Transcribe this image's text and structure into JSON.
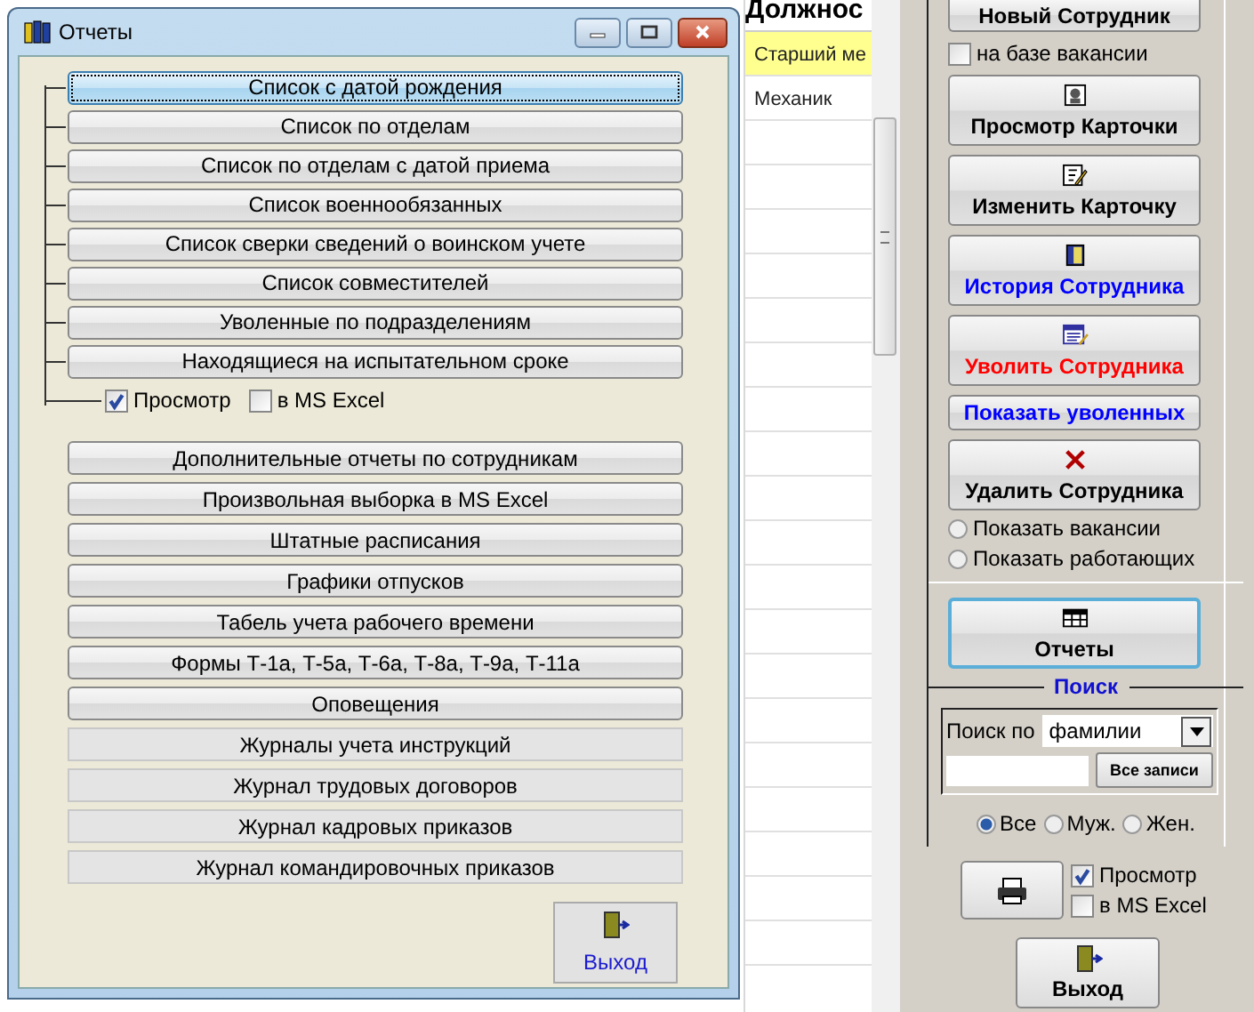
{
  "table": {
    "header": "Должнос",
    "rows": [
      {
        "cell": "Старший ме",
        "selected": true
      },
      {
        "cell": "Механик",
        "selected": false
      }
    ]
  },
  "side_panel": {
    "top_button": "Новый Сотрудник",
    "vacancy_check": {
      "label": "на базе вакансии",
      "checked": false
    },
    "buttons": [
      {
        "label": "Просмотр Карточки",
        "kind": "view",
        "color": "#000000"
      },
      {
        "label": "Изменить Карточку",
        "kind": "edit",
        "color": "#000000"
      },
      {
        "label": "История Сотрудника",
        "kind": "history",
        "color": "#0000ff"
      },
      {
        "label": "Уволить Сотрудника",
        "kind": "dismiss",
        "color": "#ff0000"
      },
      {
        "label": "Показать уволенных",
        "kind": "plain",
        "color": "#0000ff"
      },
      {
        "label": "Удалить Сотрудника",
        "kind": "delete",
        "color": "#000000"
      }
    ],
    "show_radios": [
      {
        "label": "Показать вакансии",
        "selected": false
      },
      {
        "label": "Показать работающих",
        "selected": false
      }
    ],
    "reports_button": "Отчеты",
    "search": {
      "title": "Поиск",
      "by_label": "Поиск по",
      "by_value": "фамилии",
      "all_button": "Все записи"
    },
    "gender_radios": [
      {
        "label": "Все",
        "selected": true
      },
      {
        "label": "Муж.",
        "selected": false
      },
      {
        "label": "Жен.",
        "selected": false
      }
    ],
    "print_options": [
      {
        "label": "Просмотр",
        "checked": true
      },
      {
        "label": "в MS Excel",
        "checked": false
      }
    ],
    "exit_button": "Выход"
  },
  "dialog": {
    "title": "Отчеты",
    "tree_buttons": [
      {
        "label": "Список с датой рождения",
        "focused": true
      },
      {
        "label": "Список по отделам",
        "focused": false
      },
      {
        "label": "Список по отделам с датой приема",
        "focused": false
      },
      {
        "label": "Список военнообязанных",
        "focused": false
      },
      {
        "label": "Список сверки сведений о воинском учете",
        "focused": false
      },
      {
        "label": "Список совместителей",
        "focused": false
      },
      {
        "label": "Уволенные по подразделениям",
        "focused": false
      },
      {
        "label": "Находящиеся на испытательном сроке",
        "focused": false
      }
    ],
    "options": [
      {
        "label": "Просмотр",
        "checked": true
      },
      {
        "label": "в MS Excel",
        "checked": false
      }
    ],
    "buttons": [
      {
        "label": "Дополнительные отчеты по сотрудникам",
        "kind": "raised"
      },
      {
        "label": "Произвольная выборка в MS Excel",
        "kind": "raised"
      },
      {
        "label": "Штатные расписания",
        "kind": "raised"
      },
      {
        "label": "Графики отпусков",
        "kind": "raised"
      },
      {
        "label": "Табель учета рабочего времени",
        "kind": "raised"
      },
      {
        "label": "Формы Т-1а, Т-5а, Т-6а, Т-8а, Т-9а, Т-11а",
        "kind": "raised"
      },
      {
        "label": "Оповещения",
        "kind": "raised"
      },
      {
        "label": "Журналы учета инструкций",
        "kind": "flat"
      },
      {
        "label": "Журнал трудовых договоров",
        "kind": "flat"
      },
      {
        "label": "Журнал кадровых приказов",
        "kind": "flat"
      },
      {
        "label": "Журнал командировочных приказов",
        "kind": "flat"
      }
    ],
    "exit_button": "Выход"
  }
}
